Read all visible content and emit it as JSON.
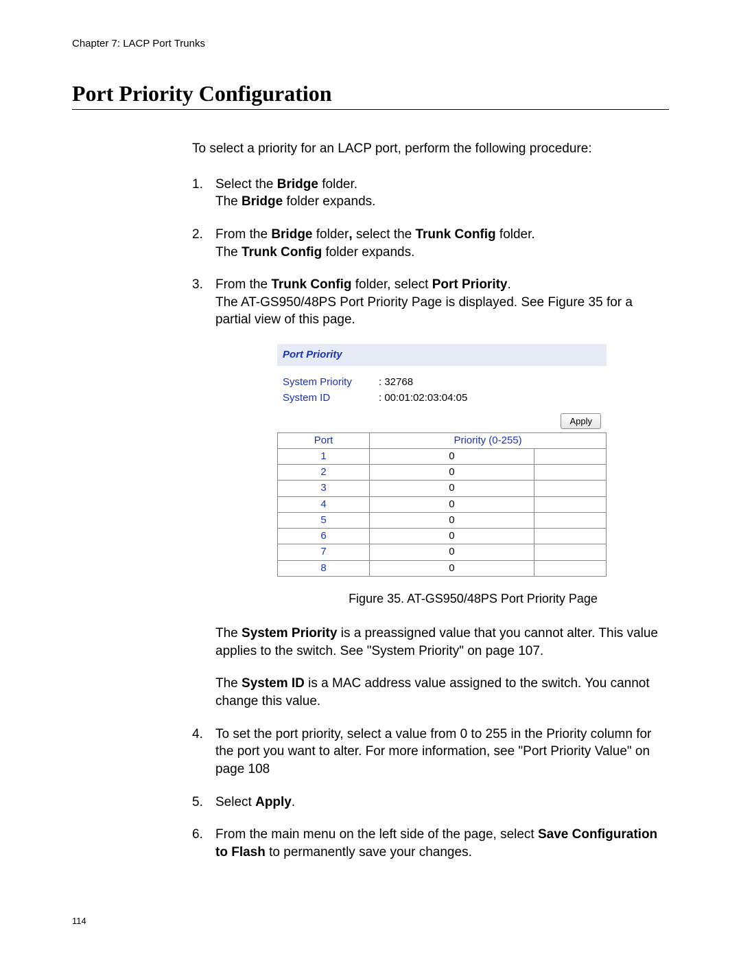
{
  "header": {
    "chapter": "Chapter 7: LACP Port Trunks"
  },
  "title": "Port Priority Configuration",
  "intro": "To select a priority for an LACP port, perform the following procedure:",
  "steps": {
    "s1a": "Select the ",
    "s1b": "Bridge",
    "s1c": " folder.",
    "s1d": "The ",
    "s1e": "Bridge",
    "s1f": " folder expands.",
    "s2a": "From the ",
    "s2b": "Bridge",
    "s2c": " folder",
    "s2comma": ", ",
    "s2d": "select the ",
    "s2e": "Trunk Config",
    "s2f": " folder.",
    "s2g": "The ",
    "s2h": "Trunk Config",
    "s2i": " folder expands.",
    "s3a": "From the ",
    "s3b": "Trunk Config",
    "s3c": " folder, select ",
    "s3d": "Port Priority",
    "s3e": ".",
    "s3f": "The AT-GS950/48PS Port Priority Page is displayed. See Figure 35 for a partial view of this page.",
    "s4": "To set the port priority, select a value from 0 to 255 in the Priority column for the port you want to alter. For more information, see \"Port Priority Value\" on page 108",
    "s5a": "Select ",
    "s5b": "Apply",
    "s5c": ".",
    "s6a": "From the main menu on the left side of the page, select ",
    "s6b": "Save Configuration to Flash",
    "s6c": " to permanently save your changes."
  },
  "figure": {
    "panel_title": "Port Priority",
    "system_priority_label": "System Priority",
    "system_priority_value": ": 32768",
    "system_id_label": "System ID",
    "system_id_value": ": 00:01:02:03:04:05",
    "apply_label": "Apply",
    "col_port": "Port",
    "col_priority": "Priority (0-255)",
    "rows": [
      {
        "port": "1",
        "priority": "0"
      },
      {
        "port": "2",
        "priority": "0"
      },
      {
        "port": "3",
        "priority": "0"
      },
      {
        "port": "4",
        "priority": "0"
      },
      {
        "port": "5",
        "priority": "0"
      },
      {
        "port": "6",
        "priority": "0"
      },
      {
        "port": "7",
        "priority": "0"
      },
      {
        "port": "8",
        "priority": "0"
      }
    ],
    "caption": "Figure 35. AT-GS950/48PS Port Priority Page"
  },
  "notes": {
    "n1a": "The ",
    "n1b": "System Priority",
    "n1c": " is a preassigned value that you cannot alter. This value applies to the switch. See \"System Priority\" on page 107.",
    "n2a": "The ",
    "n2b": "System ID",
    "n2c": " is a MAC address value assigned to the switch. You cannot change this value."
  },
  "pagenum": "114"
}
